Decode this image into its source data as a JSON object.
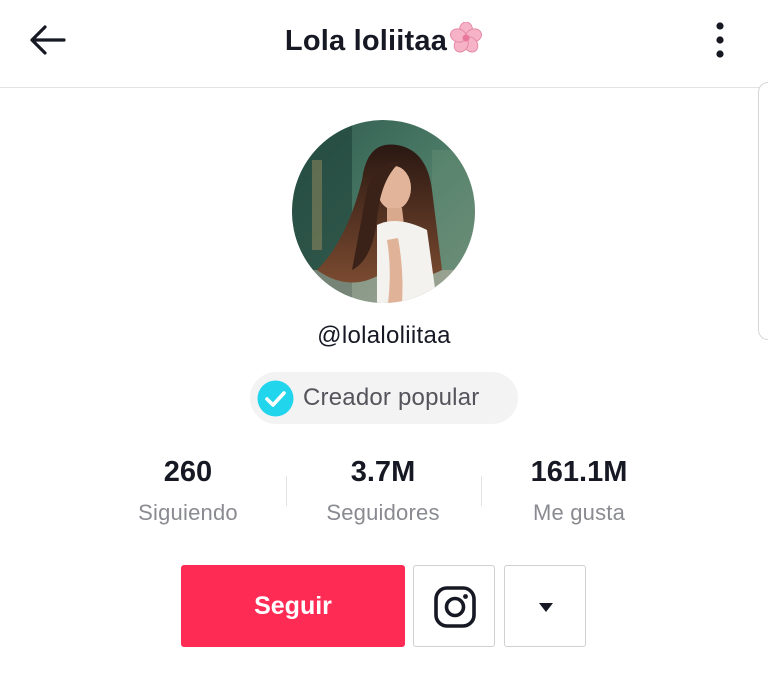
{
  "header": {
    "title": "Lola loliitaa",
    "back_icon": "arrow-left-icon",
    "more_icon": "vertical-dots-icon",
    "title_emoji": "cherry-blossom-icon"
  },
  "profile": {
    "username": "@lolaloliitaa",
    "badge_label": "Creador popular",
    "badge_icon": "verified-check-icon",
    "badge_color": "#20d5ec"
  },
  "stats": [
    {
      "value": "260",
      "label": "Siguiendo"
    },
    {
      "value": "3.7M",
      "label": "Seguidores"
    },
    {
      "value": "161.1M",
      "label": "Me gusta"
    }
  ],
  "actions": {
    "follow_label": "Seguir",
    "follow_color": "#fe2c55",
    "instagram_icon": "instagram-icon",
    "dropdown_icon": "caret-down-icon"
  }
}
